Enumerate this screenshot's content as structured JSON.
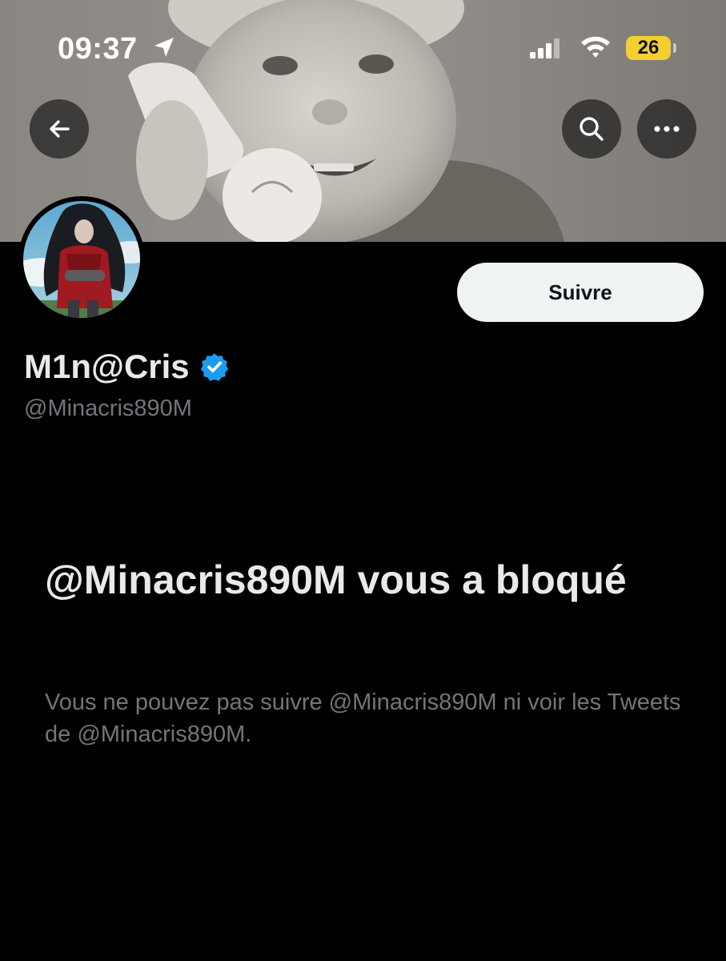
{
  "status_bar": {
    "time": "09:37",
    "battery_level": "26",
    "battery_color": "#f3cf2f",
    "icons": [
      "location-arrow-icon",
      "cellular-signal-icon",
      "wifi-icon",
      "battery-icon"
    ]
  },
  "header": {
    "back_icon": "arrow-left-icon",
    "search_icon": "search-icon",
    "more_icon": "more-horizontal-icon"
  },
  "profile": {
    "display_name": "M1n@Cris",
    "verified": true,
    "verified_color": "#1d9bf0",
    "handle": "@Minacris890M",
    "follow_label": "Suivre"
  },
  "blocked": {
    "title": "@Minacris890M vous a bloqué",
    "description": "Vous ne pouvez pas suivre @Minacris890M ni voir les Tweets de @Minacris890M."
  },
  "colors": {
    "background": "#000000",
    "primary_text": "#e7e9ea",
    "secondary_text": "#71767b",
    "follow_button_bg": "#eff3f4"
  }
}
